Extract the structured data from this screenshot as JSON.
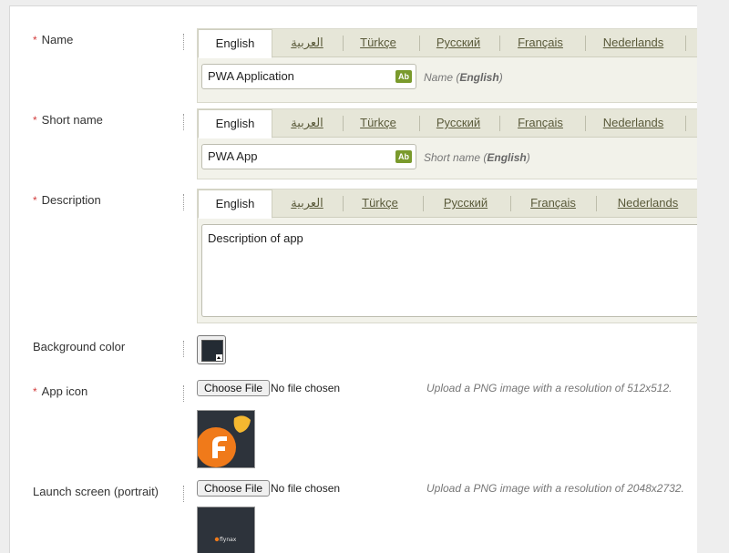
{
  "languages": [
    "English",
    "العربية",
    "Türkçe",
    "Русский",
    "Français",
    "Nederlands"
  ],
  "fields": {
    "name": {
      "label": "Name",
      "value": "PWA Application",
      "hint_prefix": "Name (",
      "hint_lang": "English",
      "hint_suffix": ")"
    },
    "short_name": {
      "label": "Short name",
      "value": "PWA App",
      "hint_prefix": "Short name (",
      "hint_lang": "English",
      "hint_suffix": ")"
    },
    "description": {
      "label": "Description",
      "value": "Description of app"
    },
    "background_color": {
      "label": "Background color",
      "value": "#232b33"
    },
    "app_icon": {
      "label": "App icon",
      "button": "Choose File",
      "status": "No file chosen",
      "hint": "Upload a PNG image with a resolution of 512x512."
    },
    "launch_screen": {
      "label": "Launch screen (portrait)",
      "button": "Choose File",
      "status": "No file chosen",
      "hint": "Upload a PNG image with a resolution of 2048x2732.",
      "thumb_text": "flynax"
    }
  },
  "icons": {
    "translate": "Ab",
    "required": "*"
  }
}
